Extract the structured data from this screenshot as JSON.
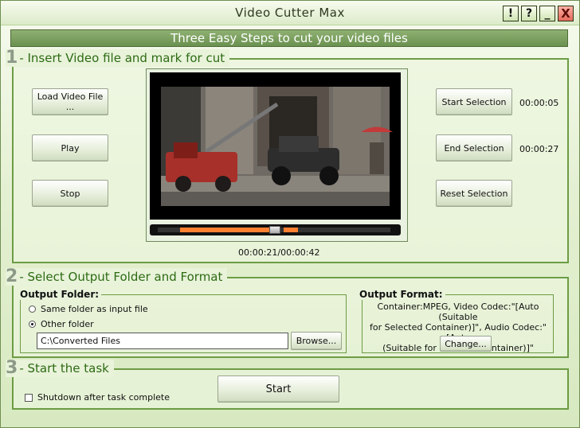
{
  "window": {
    "title": "Video Cutter Max",
    "buttons": {
      "help_bang": "!",
      "help_question": "?",
      "minimize": "_",
      "close": "X"
    }
  },
  "banner": {
    "text": "Three Easy Steps to cut your video files"
  },
  "step1": {
    "number": "1",
    "title": "- Insert Video file and mark for cut",
    "load_label": "Load Video File ...",
    "play_label": "Play",
    "stop_label": "Stop",
    "start_selection_label": "Start Selection",
    "start_time": "00:00:05",
    "end_selection_label": "End Selection",
    "end_time": "00:00:27",
    "reset_selection_label": "Reset Selection",
    "position_readout": "00:00:21/00:00:42"
  },
  "step2": {
    "number": "2",
    "title": "- Select Output Folder and Format",
    "output_folder_title": "Output Folder:",
    "same_folder_label": "Same folder as input file",
    "other_folder_label": "Other folder",
    "selected_option": "other",
    "folder_path": "C:\\Converted Files",
    "browse_label": "Browse...",
    "output_format_title": "Output Format:",
    "format_line1": "Container:MPEG, Video Codec:\"[Auto (Suitable",
    "format_line2": "for Selected Container)]\", Audio Codec:\"[Auto",
    "format_line3": "(Suitable for Selected Container)]\"",
    "change_label": "Change..."
  },
  "step3": {
    "number": "3",
    "title": "- Start the task",
    "shutdown_label": "Shutdown after task complete",
    "shutdown_checked": false,
    "start_label": "Start"
  },
  "colors": {
    "accent": "#6d9c45",
    "banner": "#7ba05f",
    "scrub_selection": "#ff8030"
  }
}
